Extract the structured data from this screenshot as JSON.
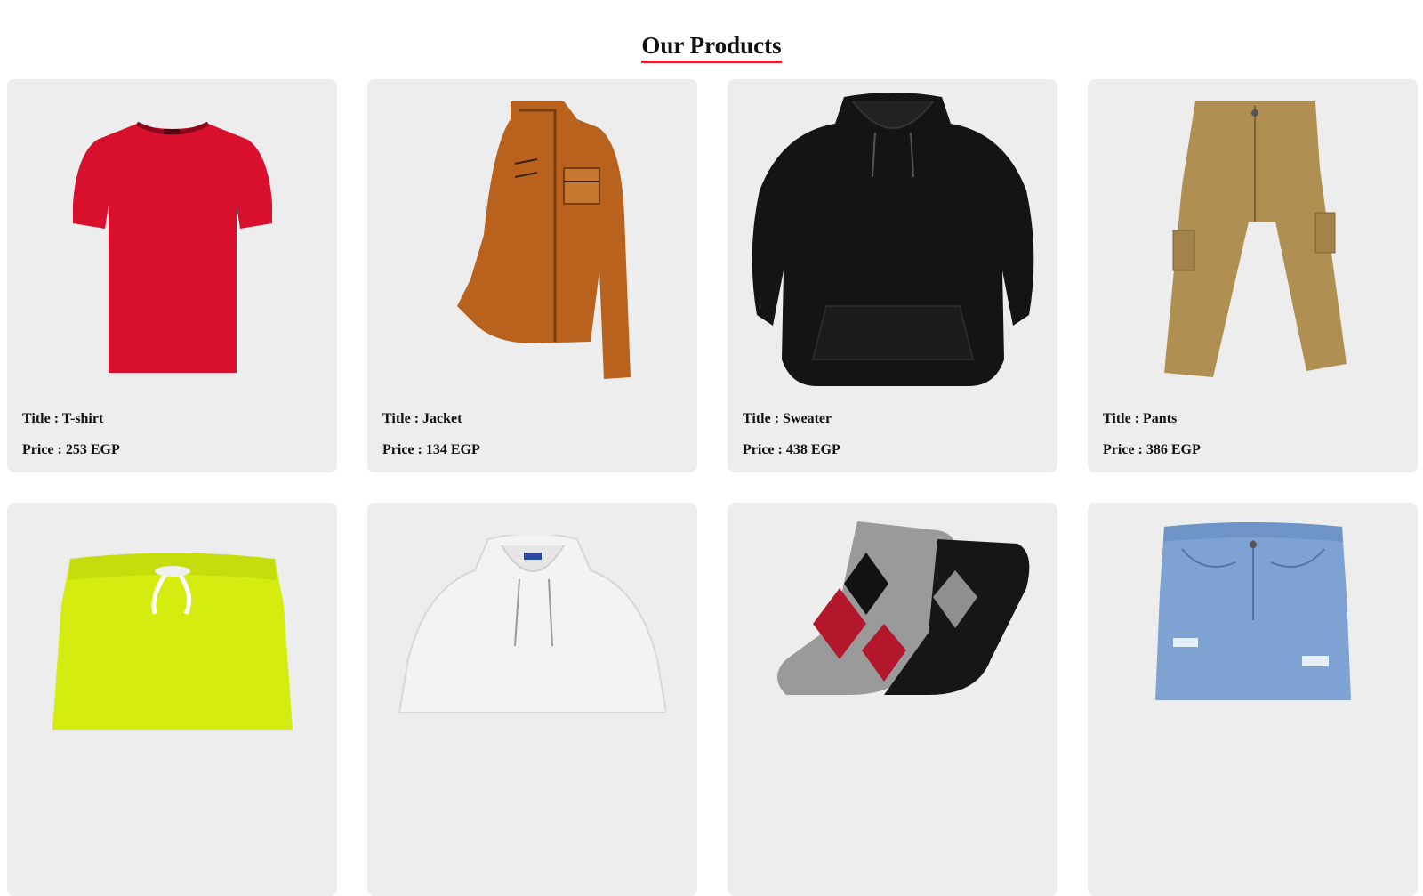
{
  "header": {
    "title": "Our Products"
  },
  "accent_color": "#e0202d",
  "card_background": "#ededed",
  "products": [
    {
      "title": "Title : T-shirt",
      "price": "Price : 253 EGP",
      "icon": "tshirt-image"
    },
    {
      "title": "Title : Jacket",
      "price": "Price : 134 EGP",
      "icon": "jacket-image"
    },
    {
      "title": "Title : Sweater",
      "price": "Price : 438 EGP",
      "icon": "sweater-image"
    },
    {
      "title": "Title : Pants",
      "price": "Price : 386 EGP",
      "icon": "pants-image"
    },
    {
      "icon": "shorts-image"
    },
    {
      "icon": "hoodie-image"
    },
    {
      "icon": "socks-image"
    },
    {
      "icon": "jeans-image"
    }
  ]
}
